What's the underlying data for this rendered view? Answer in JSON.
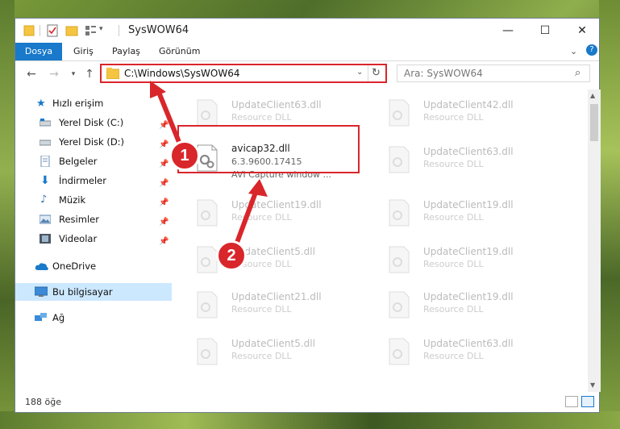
{
  "window": {
    "title": "SysWOW64",
    "controls": {
      "minimize": "—",
      "maximize": "☐",
      "close": "✕"
    }
  },
  "ribbon": {
    "tabs": [
      {
        "label": "Dosya",
        "active": true
      },
      {
        "label": "Giriş"
      },
      {
        "label": "Paylaş"
      },
      {
        "label": "Görünüm"
      }
    ],
    "help": "?"
  },
  "address": {
    "path": "C:\\Windows\\SysWOW64",
    "search_placeholder": "Ara: SysWOW64"
  },
  "sidebar": {
    "items": [
      {
        "label": "Hızlı erişim",
        "icon": "star-icon",
        "top": true
      },
      {
        "label": "Yerel Disk (C:)",
        "icon": "drive-icon",
        "pinned": true
      },
      {
        "label": "Yerel Disk (D:)",
        "icon": "drive-icon",
        "pinned": true
      },
      {
        "label": "Belgeler",
        "icon": "documents-icon",
        "pinned": true
      },
      {
        "label": "İndirmeler",
        "icon": "download-icon",
        "pinned": true
      },
      {
        "label": "Müzik",
        "icon": "music-icon",
        "pinned": true
      },
      {
        "label": "Resimler",
        "icon": "pictures-icon",
        "pinned": true
      },
      {
        "label": "Videolar",
        "icon": "video-icon",
        "pinned": true
      },
      {
        "label": "OneDrive",
        "icon": "cloud-icon",
        "top": true
      },
      {
        "label": "Bu bilgisayar",
        "icon": "computer-icon",
        "top": true,
        "selected": true
      },
      {
        "label": "Ağ",
        "icon": "network-icon",
        "top": true
      }
    ]
  },
  "files": {
    "left_column": [
      {
        "name": "UpdateClient63.dll",
        "sub": "Resource DLL"
      },
      {
        "name": "avicap32.dll",
        "sub": "6.3.9600.17415",
        "sub2": "AVI Capture window ...",
        "focused": true
      },
      {
        "name": "UpdateClient19.dll",
        "sub": "Resource DLL"
      },
      {
        "name": "UpdateClient5.dll",
        "sub": "Resource DLL"
      },
      {
        "name": "UpdateClient21.dll",
        "sub": "Resource DLL"
      },
      {
        "name": "UpdateClient5.dll",
        "sub": "Resource DLL"
      }
    ],
    "right_column": [
      {
        "name": "UpdateClient42.dll",
        "sub": "Resource DLL"
      },
      {
        "name": "UpdateClient63.dll",
        "sub": "Resource DLL"
      },
      {
        "name": "UpdateClient19.dll",
        "sub": "Resource DLL"
      },
      {
        "name": "UpdateClient19.dll",
        "sub": "Resource DLL"
      },
      {
        "name": "UpdateClient19.dll",
        "sub": "Resource DLL"
      },
      {
        "name": "UpdateClient63.dll",
        "sub": "Resource DLL"
      }
    ]
  },
  "status": {
    "count": "188 öğe"
  },
  "annotations": {
    "badge1": "1",
    "badge2": "2",
    "color": "#d9262b"
  },
  "colors": {
    "accent": "#1979ca",
    "selected": "#cce8ff"
  }
}
